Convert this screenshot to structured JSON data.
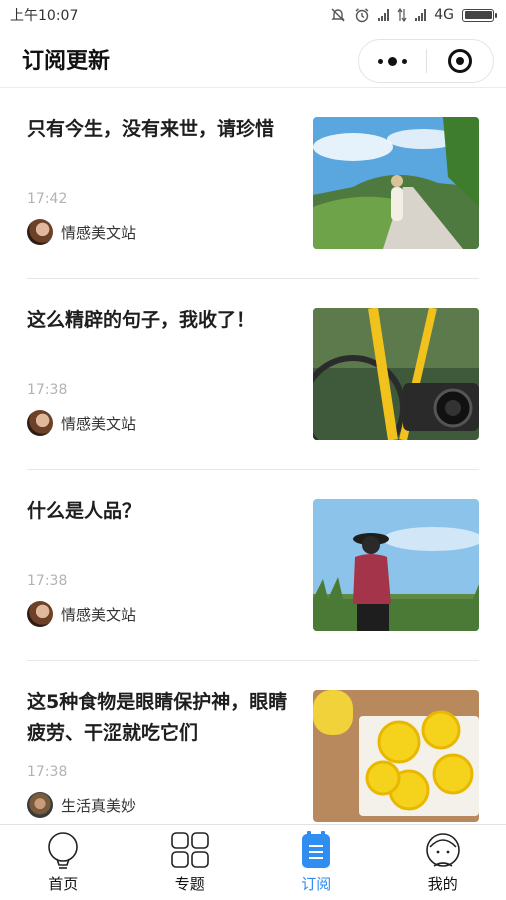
{
  "status_bar": {
    "time": "上午10:07",
    "network": "4G"
  },
  "header": {
    "title": "订阅更新"
  },
  "articles": [
    {
      "title": "只有今生，没有来世，请珍惜",
      "time": "17:42",
      "source": "情感美文站"
    },
    {
      "title": "这么精辟的句子，我收了！",
      "time": "17:38",
      "source": "情感美文站"
    },
    {
      "title": "什么是人品？",
      "time": "17:38",
      "source": "情感美文站"
    },
    {
      "title": "这5种食物是眼睛保护神，眼睛疲劳、干涩就吃它们",
      "time": "17:38",
      "source": "生活真美妙"
    }
  ],
  "tabs": [
    {
      "label": "首页",
      "icon": "bulb-icon",
      "active": false
    },
    {
      "label": "专题",
      "icon": "grid-icon",
      "active": false
    },
    {
      "label": "订阅",
      "icon": "subscription-list-icon",
      "active": true
    },
    {
      "label": "我的",
      "icon": "profile-icon",
      "active": false
    }
  ],
  "colors": {
    "accent": "#2f8ef0",
    "text_primary": "#1e1e1e",
    "text_muted": "#b3b3b3",
    "divider": "#e8e8e8"
  }
}
